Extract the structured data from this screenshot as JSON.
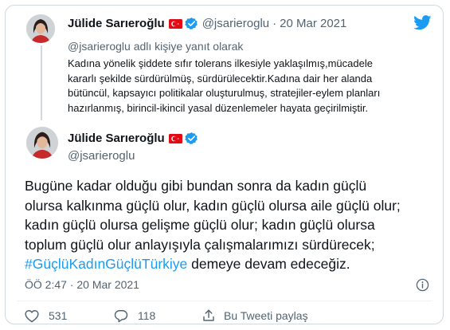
{
  "reply_tweet": {
    "author_name": "Jülide Sarıeroğlu",
    "handle": "@jsarieroglu",
    "separator": "·",
    "date": "20 Mar 2021",
    "reply_to": "@jsarieroglu adlı kişiye yanıt olarak",
    "lines": [
      "Kadına yönelik şiddete sıfır tolerans ilkesiyle yaklaşılmış,mücadele",
      "kararlı şekilde sürdürülmüş, sürdürülecektir.Kadına dair her alanda",
      "bütüncül, kapsayıcı politikalar oluşturulmuş, stratejiler-eylem planları",
      "hazırlanmış, birincil-ikincil yasal düzenlemeler hayata geçirilmiştir."
    ]
  },
  "main_tweet": {
    "author_name": "Jülide Sarıeroğlu",
    "handle": "@jsarieroglu",
    "lines": [
      "Bugüne kadar olduğu gibi bundan sonra da kadın güçlü",
      "olursa kalkınma güçlü olur, kadın güçlü olursa aile güçlü olur;",
      "kadın güçlü olursa gelişme güçlü olur; kadın güçlü olursa",
      "toplum güçlü olur anlayışıyla çalışmalarımızı sürdürecek;"
    ],
    "hashtag": "#GüçlüKadınGüçlüTürkiye",
    "last_line_rest": " demeye devam edeceğiz.",
    "timestamp": "ÖÖ 2:47 · 20 Mar 2021",
    "likes": "531",
    "replies": "118",
    "share_label": "Bu Tweeti paylaş"
  },
  "icons": {
    "brand": "twitter-bird-icon",
    "flag": "turkey-flag-icon",
    "verified": "verified-badge-icon",
    "like": "heart-icon",
    "reply": "comment-icon",
    "share": "share-icon",
    "info": "info-icon"
  },
  "colors": {
    "brand_blue": "#1d9bf0",
    "text": "#0f1419",
    "secondary": "#536471",
    "flag_red": "#e30a17"
  }
}
